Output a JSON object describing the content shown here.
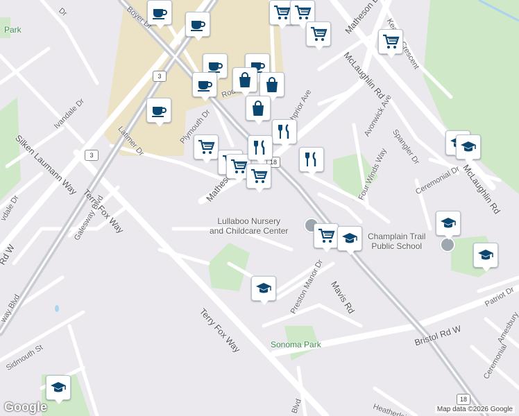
{
  "map": {
    "attribution": "Map data ©2026 Google",
    "logo": "Google"
  },
  "roads": {
    "silken_laumann": "Silken Laumann Way",
    "terry_fox_upper": "Terry Fox Way",
    "terry_fox_lower": "Terry Fox Way",
    "mavis": "Mavis Rd",
    "bristol": "Bristol Rd W",
    "mclaughlin_top": "McLaughlin Rd",
    "mclaughlin_right": "McLaughlin Rd",
    "matheson_top": "Matheson Blvd",
    "matheson_mid": "Matheson Blvd",
    "ivandale": "Ivandale Dr",
    "latimer": "Latimer Dr",
    "plymouth": "Plymouth Dr",
    "rodeo": "Rodeo Dr",
    "ashprior": "Ashprior Ave",
    "avonwick": "Avonwick Ave",
    "spangler": "Spangler Dr",
    "four_winds": "Four Winds Way",
    "ceremonial": "Ceremonial Dr",
    "galesway": "Galesway Blvd",
    "preston_manor": "Preston Manor Dr",
    "patriot": "Patriot Dr",
    "sidmouth": "Sidmouth St",
    "heatherleigh": "Heatherleigh",
    "keaton": "Keaton Crescent",
    "boyer": "Boyer Dr",
    "left_dr": "Dr",
    "left_vdale": "vdale Dr",
    "left_rd_w": "Rd W",
    "left_way": "way Blvd",
    "amesbury": "Amesbury",
    "ceremonial2": "Ceremonial",
    "calmo_blvd": "Blvd"
  },
  "shields": {
    "hwy3_a": "3",
    "hwy3_b": "3",
    "hwy18_a": "18",
    "hwy18_b": "18"
  },
  "places": {
    "lullaboo_line1": "Lullaboo Nursery",
    "lullaboo_line2": "and Childcare Center",
    "champlain_line1": "Champlain Trail",
    "champlain_line2": "Public School",
    "sonoma": "Sonoma Park",
    "park_top": "Park"
  },
  "colors": {
    "road": "#ffffff",
    "highway": "#c9ccd3",
    "commercial": "#ece2c6",
    "park": "#cfe8c7",
    "pin_icon": "#0b4770",
    "water": "#a9d3f2"
  },
  "pins": [
    {
      "type": "cafe-icon"
    },
    {
      "type": "cafe-icon"
    },
    {
      "type": "cafe-icon"
    },
    {
      "type": "cafe-icon"
    },
    {
      "type": "cafe-icon"
    },
    {
      "type": "cafe-icon"
    },
    {
      "type": "shopping-cart-icon"
    },
    {
      "type": "shopping-cart-icon"
    },
    {
      "type": "shopping-cart-icon"
    },
    {
      "type": "shopping-cart-icon"
    },
    {
      "type": "shopping-cart-icon"
    },
    {
      "type": "shopping-cart-icon"
    },
    {
      "type": "shopping-cart-icon"
    },
    {
      "type": "shopping-cart-icon"
    },
    {
      "type": "shopping-cart-icon"
    },
    {
      "type": "shopping-bag-icon"
    },
    {
      "type": "shopping-bag-icon"
    },
    {
      "type": "shopping-bag-icon"
    },
    {
      "type": "restaurant-icon"
    },
    {
      "type": "restaurant-icon"
    },
    {
      "type": "restaurant-icon"
    },
    {
      "type": "school-icon"
    },
    {
      "type": "school-icon"
    },
    {
      "type": "school-icon"
    },
    {
      "type": "school-icon"
    },
    {
      "type": "school-icon"
    },
    {
      "type": "school-icon"
    },
    {
      "type": "school-icon"
    }
  ]
}
